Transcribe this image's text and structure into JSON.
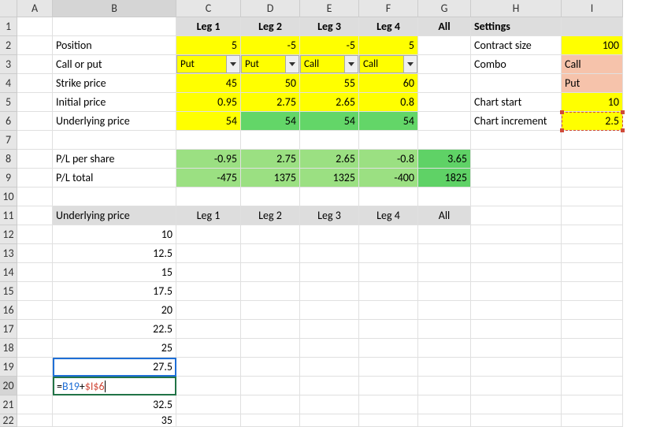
{
  "columns": [
    "A",
    "B",
    "C",
    "D",
    "E",
    "F",
    "G",
    "H",
    "I"
  ],
  "rows": [
    "1",
    "2",
    "3",
    "4",
    "5",
    "6",
    "7",
    "8",
    "9",
    "10",
    "11",
    "12",
    "13",
    "14",
    "15",
    "16",
    "17",
    "18",
    "19",
    "20",
    "21",
    "22"
  ],
  "labels": {
    "position": "Position",
    "call_or_put": "Call or put",
    "strike_price": "Strike price",
    "initial_price": "Initial price",
    "underlying_price": "Underlying price",
    "pl_per_share": "P/L per share",
    "pl_total": "P/L total",
    "underlying_price_h": "Underlying price",
    "settings": "Settings",
    "contract_size": "Contract size",
    "combo": "Combo",
    "chart_start": "Chart start",
    "chart_increment": "Chart increment"
  },
  "legs": {
    "leg1": "Leg 1",
    "leg2": "Leg 2",
    "leg3": "Leg 3",
    "leg4": "Leg 4",
    "all": "All"
  },
  "values": {
    "pos": {
      "c": "5",
      "d": "-5",
      "e": "-5",
      "f": "5"
    },
    "type": {
      "c": "Put",
      "d": "Put",
      "e": "Call",
      "f": "Call"
    },
    "strike": {
      "c": "45",
      "d": "50",
      "e": "55",
      "f": "60"
    },
    "init": {
      "c": "0.95",
      "d": "2.75",
      "e": "2.65",
      "f": "0.8"
    },
    "under": {
      "c": "54",
      "d": "54",
      "e": "54",
      "f": "54"
    },
    "pls": {
      "c": "-0.95",
      "d": "2.75",
      "e": "2.65",
      "f": "-0.8",
      "g": "3.65"
    },
    "plt": {
      "c": "-475",
      "d": "1375",
      "e": "1325",
      "f": "-400",
      "g": "1825"
    }
  },
  "settings": {
    "contract_size": "100",
    "combo1": "Call",
    "combo2": "Put",
    "chart_start": "10",
    "chart_increment": "2.5"
  },
  "series": {
    "b12": "10",
    "b13": "12.5",
    "b14": "15",
    "b15": "17.5",
    "b16": "20",
    "b17": "22.5",
    "b18": "25",
    "b19": "27.5",
    "b21": "32.5",
    "b22": "35"
  },
  "formula": {
    "prefix": "=",
    "ref1": "B19",
    "plus": "+",
    "ref2": "$I$6"
  }
}
